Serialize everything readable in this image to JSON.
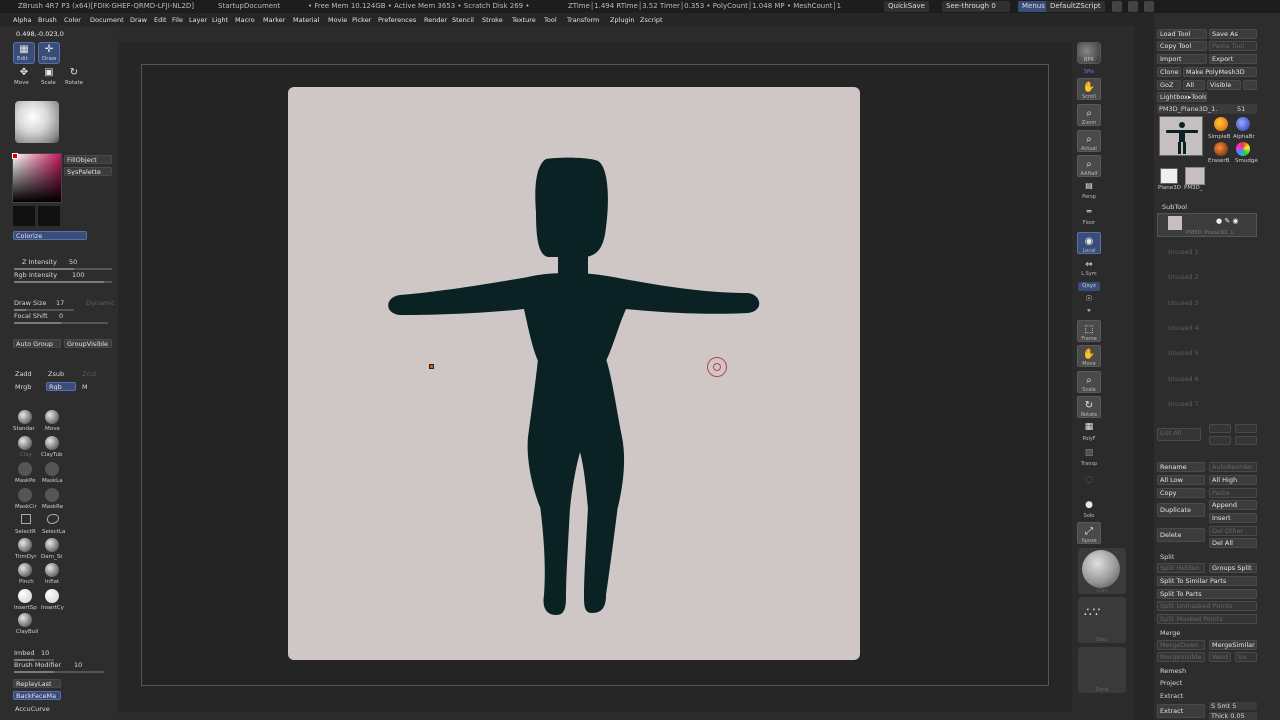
{
  "titlebar": {
    "app": "ZBrush 4R7 P3 (x64)[FDIK-GHEF-QRMD-LFJI-NL2D]",
    "doc": "StartupDocument",
    "stats": "• Free Mem 10.124GB • Active Mem 3653 • Scratch Disk 269 •",
    "timing": "ZTime│1.494 RTime│3.52 Timer│0.353 • PolyCount│1.048 MP • MeshCount│1",
    "quicksave": "QuickSave",
    "seethrough": "See-through",
    "seethrough_value": "0",
    "menus": "Menus",
    "script": "DefaultZScript"
  },
  "menubar": [
    "Alpha",
    "Brush",
    "Color",
    "Document",
    "Draw",
    "Edit",
    "File",
    "Layer",
    "Light",
    "Macro",
    "Marker",
    "Material",
    "Movie",
    "Picker",
    "Preferences",
    "Render",
    "Stencil",
    "Stroke",
    "Texture",
    "Tool",
    "Transform",
    "Zplugin",
    "Zscript"
  ],
  "coords": "0.498,-0.023,0",
  "left": {
    "edit": "Edit",
    "draw": "Draw",
    "move": "Move",
    "scale": "Scale",
    "rotate": "Rotate",
    "fillobject": "FillObject",
    "syspalette": "SysPalette",
    "colorize": "Colorize",
    "z_intensity_label": "Z Intensity",
    "z_intensity_value": "50",
    "rgb_intensity_label": "Rgb Intensity",
    "rgb_intensity_value": "100",
    "draw_size_label": "Draw Size",
    "draw_size_value": "17",
    "dynamic": "Dynamic",
    "focal_shift_label": "Focal Shift",
    "focal_shift_value": "0",
    "auto_group": "Auto Group",
    "group_visible": "GroupVisible",
    "zadd": "Zadd",
    "zsub": "Zsub",
    "zcut": "Zcut",
    "mrgb": "Mrgb",
    "rgb": "Rgb",
    "m": "M",
    "brushes": [
      "Standar",
      "Move",
      "Clay",
      "ClayTub",
      "MaskPe",
      "MaskLa",
      "MaskCir",
      "MaskRe",
      "SelectR",
      "SelectLa",
      "TrimDyr",
      "Dam_St",
      "Pinch",
      "Inflat",
      "InsertSp",
      "InsertCy",
      "ClayBuil"
    ],
    "imbed_label": "Imbed",
    "imbed_value": "10",
    "brush_modifier_label": "Brush Modifier",
    "brush_modifier_value": "10",
    "replaylast": "ReplayLast",
    "backfacemask": "BackFaceMa",
    "accucurve": "AccuCurve"
  },
  "rightshelf": [
    "BPR",
    "SPix",
    "Scroll",
    "Zoom",
    "Actual",
    "AAHalf",
    "Persp",
    "Floor",
    "Local",
    "L.Sym",
    "Qxyz",
    "Frame",
    "Move",
    "Scale",
    "Rotate",
    "PolyF",
    "Transp",
    "Solo",
    "Xpose",
    "Clay",
    "Dots",
    "Dyna"
  ],
  "tool": {
    "load_tool": "Load Tool",
    "save_as": "Save As",
    "copy_tool": "Copy Tool",
    "paste_tool": "Paste Tool",
    "import": "Import",
    "export": "Export",
    "clone": "Clone",
    "make_polymesh": "Make PolyMesh3D",
    "goz": "GoZ",
    "all": "All",
    "visible": "Visible",
    "lightbox_tools": "Lightbox▸Tools",
    "current_tool": "PM3D_Plane3D_1.",
    "current_tool_value": "51",
    "thumbs": [
      "SimpleB",
      "AlphaBr",
      "EraserB",
      "Smudge",
      "Plane3D",
      "PM3D_"
    ],
    "subtool_header": "SubTool",
    "subtool_name": "PM3D_Plane3D_1",
    "unused": [
      "Unused 1",
      "Unused 2",
      "Unused 3",
      "Unused 4",
      "Unused 5",
      "Unused 6",
      "Unused 7"
    ],
    "list_all": "List All",
    "rename": "Rename",
    "autoreorder": "AutoReorder",
    "all_low": "All Low",
    "all_high": "All High",
    "copy": "Copy",
    "paste": "Paste",
    "append": "Append",
    "duplicate": "Duplicate",
    "insert": "Insert",
    "delete": "Delete",
    "del_other": "Del Other",
    "del_all": "Del All",
    "split_header": "Split",
    "split_hidden": "Split Hidden",
    "groups_split": "Groups Split",
    "split_similar": "Split To Similar Parts",
    "split_parts": "Split To Parts",
    "split_unmasked": "Split Unmasked Points",
    "split_masked": "Split Masked Points",
    "merge_header": "Merge",
    "merge_down": "MergeDown",
    "merge_similar": "MergeSimilar",
    "merge_visible": "MergeVisible",
    "weld": "Weld",
    "uv": "Uv",
    "remesh": "Remesh",
    "project": "Project",
    "extract": "Extract",
    "extract_btn": "Extract",
    "s_smt": "S Smt 5",
    "thick": "Thick 0.05"
  }
}
